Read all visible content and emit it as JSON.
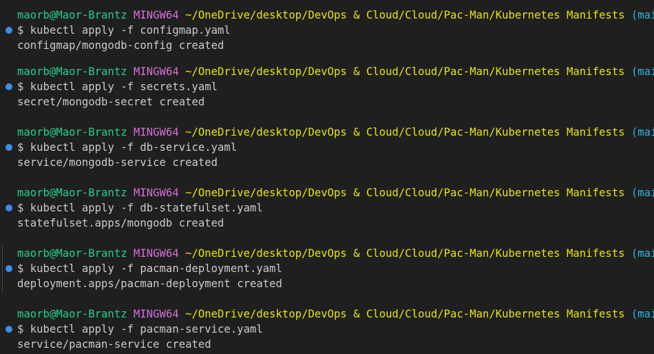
{
  "terminal": {
    "prompt": {
      "user_host": "maorb@Maor-Brantz",
      "shell": "MINGW64",
      "path": "~/OneDrive/desktop/DevOps & Cloud/Cloud/Pac-Man/Kubernetes Manifests",
      "branch": "(main)",
      "symbol": "$"
    },
    "entries": [
      {
        "command": "kubectl apply -f configmap.yaml",
        "output": "configmap/mongodb-config created"
      },
      {
        "command": "kubectl apply -f secrets.yaml",
        "output": "secret/mongodb-secret created"
      },
      {
        "command": "kubectl apply -f db-service.yaml",
        "output": "service/mongodb-service created"
      },
      {
        "command": "kubectl apply -f db-statefulset.yaml",
        "output": "statefulset.apps/mongodb created"
      },
      {
        "command": "kubectl apply -f pacman-deployment.yaml",
        "output": "deployment.apps/pacman-deployment created"
      },
      {
        "command": "kubectl apply -f pacman-service.yaml",
        "output": "service/pacman-service created"
      }
    ],
    "colors": {
      "background": "#1f1f1f",
      "user_host": "#23d18b",
      "shell": "#d670d6",
      "path": "#e5e510",
      "branch": "#29b8db",
      "text": "#cccccc",
      "decoration": "#3b8eea"
    },
    "icons": {
      "command_decoration": "command-success-dot-icon"
    }
  }
}
